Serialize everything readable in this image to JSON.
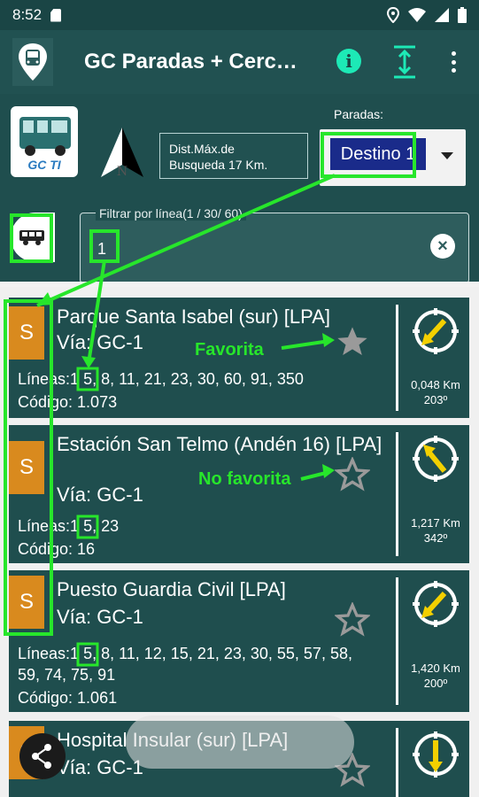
{
  "statusbar": {
    "time": "8:52"
  },
  "appbar": {
    "title": "GC Paradas + Cerc…",
    "info_icon": "info-icon",
    "expand_icon": "expand-icon",
    "menu_icon": "more-vert-icon"
  },
  "header": {
    "logo_text": "GC TI",
    "dist_line1": "Dist.Máx.de",
    "dist_line2": "Busqueda 17 Km.",
    "paradas_label": "Paradas:",
    "destino": "Destino 1",
    "filter_label": "Filtrar por línea(1 / 30/ 60)",
    "filter_value": "1"
  },
  "annotations": {
    "favorita": "Favorita",
    "no_favorita": "No favorita"
  },
  "stops": [
    {
      "badge": "S",
      "name": "Parque Santa Isabel (sur) [LPA]",
      "via": "Vía: GC-1",
      "lineas": "Líneas:",
      "lineas_first": "1",
      "lineas_rest": " 5, 8, 11, 21, 23, 30, 60, 91, 350",
      "codigo": "Código: 1.073",
      "dist": "0,048 Km",
      "deg": "203º",
      "favorite": true
    },
    {
      "badge": "S",
      "name": "Estación San Telmo (Andén 16) [LPA]",
      "via": "Vía: GC-1",
      "lineas": "Líneas:",
      "lineas_first": "1",
      "lineas_rest": " 5, 23",
      "codigo": "Código: 16",
      "dist": "1,217 Km",
      "deg": "342º",
      "favorite": false
    },
    {
      "badge": "S",
      "name": "Puesto Guardia Civil [LPA]",
      "via": "Vía: GC-1",
      "lineas": "Líneas:",
      "lineas_first": "1",
      "lineas_rest": " 5, 8, 11, 12, 15, 21, 23, 30, 55, 57, 58, 59, 74, 75, 91",
      "codigo": "Código: 1.061",
      "dist": "1,420 Km",
      "deg": "200º",
      "favorite": false
    },
    {
      "badge": "S",
      "name": "Hospital Insular (sur) [LPA]",
      "via": "Vía: GC-1",
      "favorite": false
    }
  ],
  "colors": {
    "accent_green": "#27e62b",
    "badge_orange": "#d98a1e",
    "teal_bg": "#1f4e4e"
  }
}
